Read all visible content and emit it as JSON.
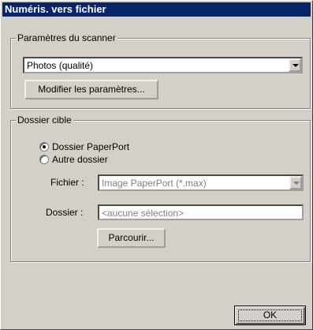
{
  "window": {
    "title": "Numéris. vers fichier"
  },
  "scanner_group": {
    "label": "Paramètres du scanner",
    "preset_value": "Photos (qualité)",
    "modify_button": "Modifier les paramètres..."
  },
  "target_group": {
    "label": "Dossier cible",
    "radio_paperport": {
      "label": "Dossier PaperPort",
      "checked": true
    },
    "radio_other": {
      "label": "Autre dossier",
      "checked": false
    },
    "file_label": "Fichier :",
    "file_value": "Image PaperPort (*.max)",
    "folder_label": "Dossier :",
    "folder_value": "<aucune sélection>",
    "browse_button": "Parcourir..."
  },
  "ok_button": "OK"
}
